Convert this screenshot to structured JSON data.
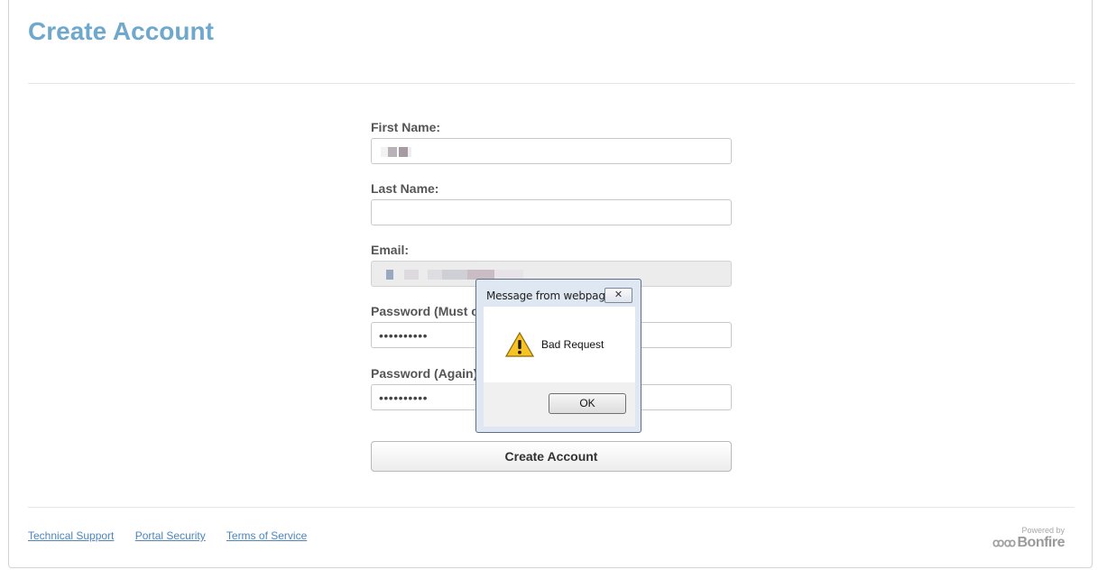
{
  "page": {
    "title": "Create Account"
  },
  "form": {
    "first_name": {
      "label": "First Name:"
    },
    "last_name": {
      "label": "Last Name:"
    },
    "email": {
      "label": "Email:"
    },
    "password": {
      "label": "Password (Must c",
      "value": "••••••••••"
    },
    "password_again": {
      "label": "Password (Again)",
      "value": "••••••••••"
    },
    "submit_label": "Create Account"
  },
  "footer": {
    "links": [
      "Technical Support",
      "Portal Security",
      "Terms of Service"
    ],
    "powered_by": "Powered by",
    "brand": "Bonfire",
    "brand_icon": "bonfire-logo-icon"
  },
  "dialog": {
    "title": "Message from webpage",
    "close_glyph": "✕",
    "message": "Bad Request",
    "icon": "warning-icon",
    "ok_label": "OK"
  },
  "colors": {
    "title": "#6fa8cd",
    "link": "#4d86bc"
  }
}
